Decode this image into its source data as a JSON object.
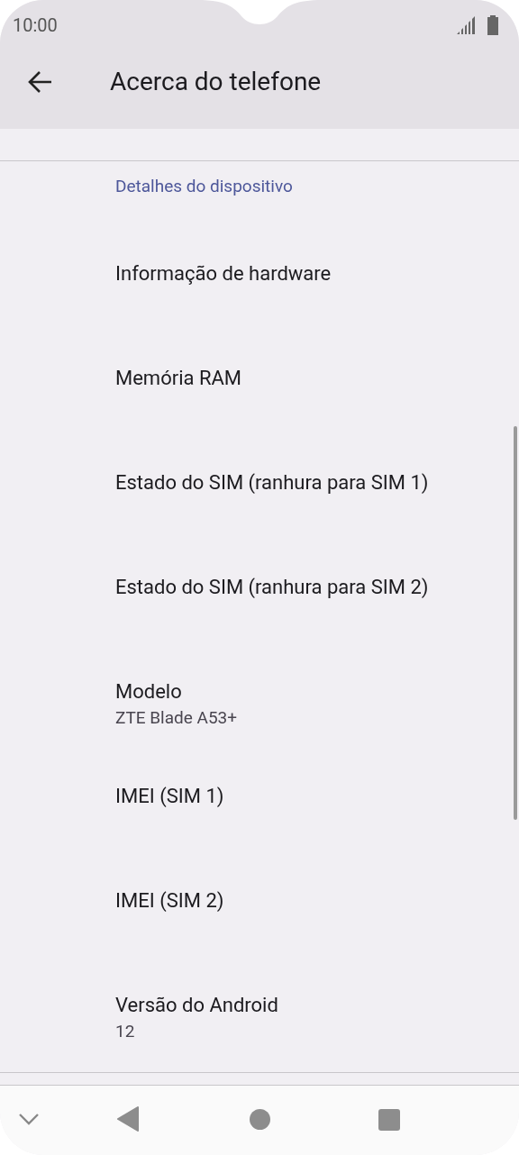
{
  "status_bar": {
    "time": "10:00"
  },
  "toolbar": {
    "title": "Acerca do telefone"
  },
  "category": "Detalhes do dispositivo",
  "items": [
    {
      "title": "Informação de hardware"
    },
    {
      "title": "Memória RAM"
    },
    {
      "title": "Estado do SIM (ranhura para SIM 1)"
    },
    {
      "title": "Estado do SIM (ranhura para SIM 2)"
    },
    {
      "title": "Modelo",
      "summary": "ZTE Blade A53+"
    },
    {
      "title": "IMEI (SIM 1)"
    },
    {
      "title": "IMEI (SIM 2)"
    },
    {
      "title": "Versão do Android",
      "summary": "12"
    }
  ]
}
